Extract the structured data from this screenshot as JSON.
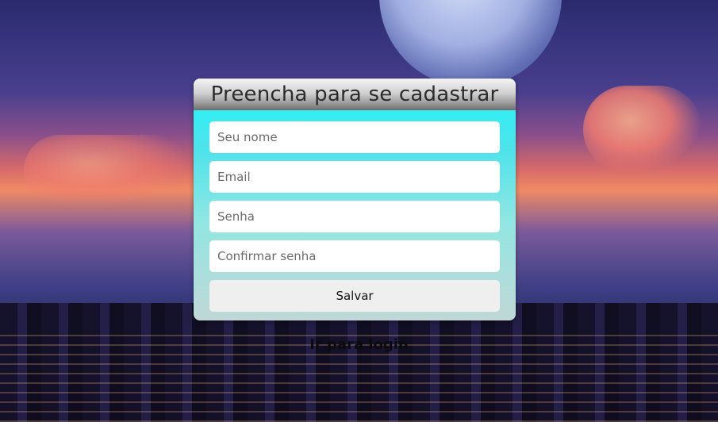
{
  "form": {
    "title": "Preencha para se cadastrar",
    "fields": [
      {
        "placeholder": "Seu nome",
        "value": ""
      },
      {
        "placeholder": "Email",
        "value": ""
      },
      {
        "placeholder": "Senha",
        "value": ""
      },
      {
        "placeholder": "Confirmar senha",
        "value": ""
      }
    ],
    "submit_label": "Salvar"
  },
  "links": {
    "login_label": "Ir para login"
  },
  "colors": {
    "card_top": "#1ff6fb",
    "card_bottom": "#c0d8d6",
    "header_light": "#f4f4f4",
    "header_dark": "#6f6f6f",
    "button_bg": "#efefef",
    "title_text": "#2b2b2b"
  }
}
